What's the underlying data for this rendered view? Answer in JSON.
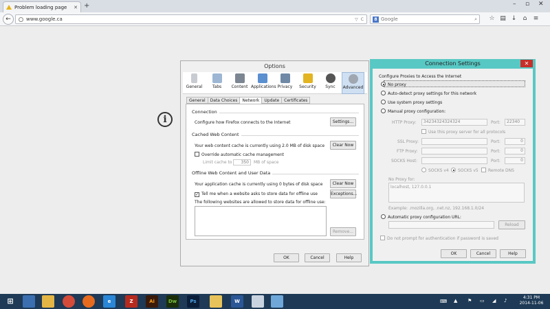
{
  "browser": {
    "tab_title": "Problem loading page",
    "new_tab_label": "+",
    "url": "www.google.ca",
    "search_placeholder": "Google",
    "search_engine_letter": "8"
  },
  "options": {
    "title": "Options",
    "categories": [
      "General",
      "Tabs",
      "Content",
      "Applications",
      "Privacy",
      "Security",
      "Sync",
      "Advanced"
    ],
    "subtabs": [
      "General",
      "Data Choices",
      "Network",
      "Update",
      "Certificates"
    ],
    "connection": {
      "heading": "Connection",
      "text": "Configure how Firefox connects to the Internet",
      "button": "Settings..."
    },
    "cache": {
      "heading": "Cached Web Content",
      "text": "Your web content cache is currently using 2.0 MB of disk space",
      "clear_button": "Clear Now",
      "override_label": "Override automatic cache management",
      "limit_label": "Limit cache to",
      "limit_value": "350",
      "limit_unit": "MB of space"
    },
    "offline": {
      "heading": "Offline Web Content and User Data",
      "text": "Your application cache is currently using 0 bytes of disk space",
      "clear_button": "Clear Now",
      "tell_label": "Tell me when a website asks to store data for offline use",
      "exceptions_button": "Exceptions...",
      "allowed_label": "The following websites are allowed to store data for offline use:",
      "remove_button": "Remove..."
    },
    "ok": "OK",
    "cancel": "Cancel",
    "help": "Help"
  },
  "conn": {
    "title": "Connection Settings",
    "close": "✕",
    "heading": "Configure Proxies to Access the Internet",
    "no_proxy": "No proxy",
    "auto_detect": "Auto-detect proxy settings for this network",
    "system": "Use system proxy settings",
    "manual": "Manual proxy configuration:",
    "http_label": "HTTP Proxy:",
    "http_value": "34234324324324",
    "port_label": "Port:",
    "http_port": "22340",
    "same_proxy": "Use this proxy server for all protocols",
    "ssl_label": "SSL Proxy:",
    "ftp_label": "FTP Proxy:",
    "socks_label": "SOCKS Host:",
    "zero": "0",
    "socks4": "SOCKS v4",
    "socks5": "SOCKS v5",
    "remote_dns": "Remote DNS",
    "no_proxy_for": "No Proxy for:",
    "no_proxy_value": "localhost, 127.0.0.1",
    "example": "Example: .mozilla.org, .net.nz, 192.168.1.0/24",
    "auto_url": "Automatic proxy configuration URL:",
    "reload": "Reload",
    "no_prompt": "Do not prompt for authentication if password is saved",
    "ok": "OK",
    "cancel": "Cancel",
    "help": "Help"
  },
  "taskbar": {
    "time": "4:31 PM",
    "date": "2014-11-06"
  },
  "colors": {
    "accent": "#58c8c4",
    "close": "#c7302a",
    "taskbar": "#1e3a56"
  }
}
